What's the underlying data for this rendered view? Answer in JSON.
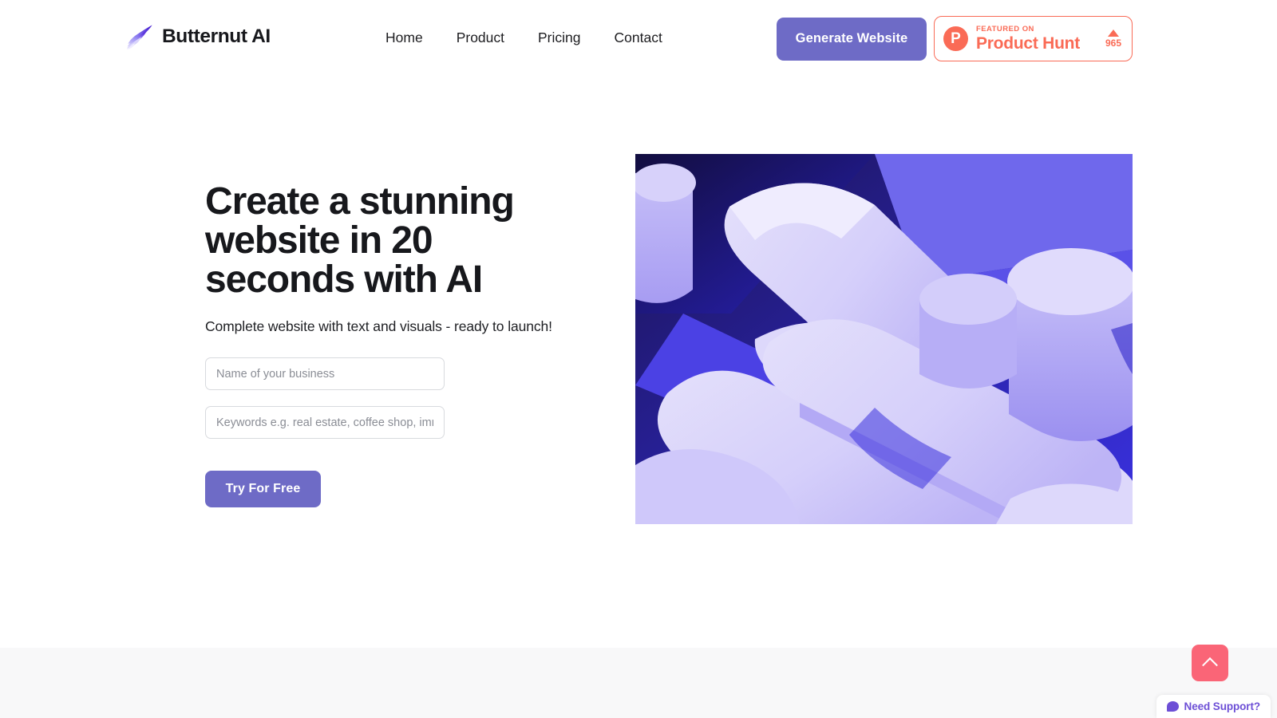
{
  "brand": {
    "name": "Butternut AI",
    "logo_icon": "butternut-wing-logo",
    "gradient_from": "#b9b2f5",
    "gradient_to": "#4a1ecf"
  },
  "nav": {
    "items": [
      {
        "label": "Home"
      },
      {
        "label": "Product"
      },
      {
        "label": "Pricing"
      },
      {
        "label": "Contact"
      }
    ]
  },
  "header": {
    "generate_button": "Generate Website",
    "generate_button_color": "#6e6bc6",
    "product_hunt": {
      "logo_letter": "P",
      "kicker": "FEATURED ON",
      "title": "Product Hunt",
      "vote_count": "965",
      "accent_color": "#fa6b56",
      "upvote_icon": "triangle-up-icon"
    }
  },
  "hero": {
    "title": "Create a stunning website in 20 seconds with AI",
    "subtitle": "Complete website with text and visuals - ready to launch!",
    "fields": [
      {
        "name": "business-name",
        "placeholder": "Name of your business",
        "value": ""
      },
      {
        "name": "keywords",
        "placeholder": "Keywords e.g. real estate, coffee shop, immigration lawyer",
        "value": ""
      }
    ],
    "cta_label": "Try For Free",
    "cta_color": "#6e6bc6",
    "visual_alt": "abstract-3d-purple-capsule-shapes"
  },
  "floating": {
    "scroll_top": {
      "icon": "chevron-up-icon",
      "color": "#fa6577"
    },
    "support": {
      "label": "Need Support?",
      "icon": "chat-bubble-icon",
      "color": "#6d4fd6"
    }
  },
  "below_section": {
    "background": "#f8f8f9"
  }
}
